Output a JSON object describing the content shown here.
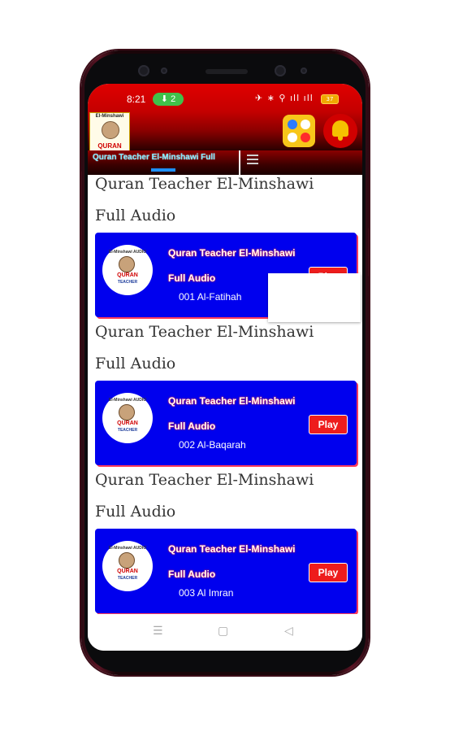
{
  "status": {
    "time": "8:21",
    "notif_count": "2",
    "icons": "✈ ∗ ⚲ ıll ıll",
    "battery": "37"
  },
  "appbar": {
    "logo_top": "El-Minshawi",
    "logo_bottom": "QURAN",
    "game_icon": "game-dots-icon",
    "bell_icon": "notification-bell-icon"
  },
  "tab": {
    "label": "Quran Teacher El-Minshawi Full",
    "menu_icon": "hamburger-menu-icon"
  },
  "card_logo": {
    "top": "El-Minshawi AUDIO",
    "mid": "QURAN",
    "bottom": "TEACHER"
  },
  "items": [
    {
      "section": "Quran Teacher El-Minshawi Full Audio",
      "title": "Quran Teacher El-Minshawi Full Audio",
      "subtitle": "001 Al-Fatihah",
      "play": "Play"
    },
    {
      "section": "Quran Teacher El-Minshawi Full Audio",
      "title": "Quran Teacher El-Minshawi Full Audio",
      "subtitle": "002 Al-Baqarah",
      "play": "Play"
    },
    {
      "section": "Quran Teacher El-Minshawi Full Audio",
      "title": "Quran Teacher El-Minshawi Full Audio",
      "subtitle": "003 Al Imran",
      "play": "Play"
    }
  ],
  "nav": {
    "recents": "☰",
    "home": "▢",
    "back": "◁"
  },
  "colors": {
    "statusbar": "#e00000",
    "card": "#0000ee",
    "play": "#ee1c1c",
    "tab_text": "#7ee8ff"
  }
}
